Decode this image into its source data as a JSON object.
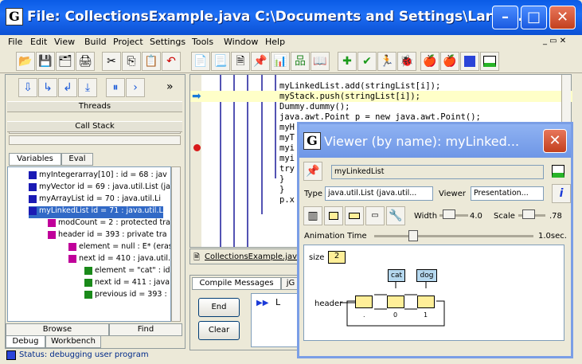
{
  "window": {
    "title": "File: CollectionsExample.java  C:\\Documents and Settings\\Larry\\..."
  },
  "menu": [
    "File",
    "Edit",
    "View",
    "Build",
    "Project",
    "Settings",
    "Tools",
    "Window",
    "Help"
  ],
  "left_panel": {
    "threads_label": "Threads",
    "callstack_label": "Call Stack",
    "tabs": [
      "Variables",
      "Eval"
    ],
    "tree": [
      {
        "text": "myIntegerarray[10] : id = 68 : jav",
        "color": "#1a1ab4",
        "indent": 26
      },
      {
        "text": "myVector id = 69 : java.util.List (ja",
        "color": "#1a1ab4",
        "indent": 26
      },
      {
        "text": "myArrayList id = 70 : java.util.Li",
        "color": "#1a1ab4",
        "indent": 26
      },
      {
        "text": "myLinkedList id = 71 : java.util.L",
        "color": "#1a1ab4",
        "indent": 26
      },
      {
        "text": "modCount = 2 : protected tra",
        "color": "#c0009a",
        "indent": 50
      },
      {
        "text": "header id = 393 : private tra",
        "color": "#c0009a",
        "indent": 50
      },
      {
        "text": "element = null : E* (eras",
        "color": "#c0009a",
        "indent": 76
      },
      {
        "text": "next id = 410 : java.util.l",
        "color": "#c0009a",
        "indent": 76
      },
      {
        "text": "element = \"cat\" : id",
        "color": "#1a8a1a",
        "indent": 96
      },
      {
        "text": "next id = 411 : java.",
        "color": "#1a8a1a",
        "indent": 96
      },
      {
        "text": "previous id = 393 : ",
        "color": "#1a8a1a",
        "indent": 96
      }
    ],
    "bottom_tabs": [
      "Browse",
      "Find"
    ],
    "mode_tabs": [
      "Debug",
      "Workbench"
    ]
  },
  "status": "Status: debugging user program",
  "editor": {
    "lines": [
      "myLinkedList.add(stringList[i]);",
      "myStack.push(stringList[i]);",
      "Dummy.dummy();",
      "java.awt.Point p = new java.awt.Point();",
      "myH",
      "myT",
      "myi",
      "myi",
      "try",
      "}",
      "}",
      "p.x"
    ],
    "file_tab": "CollectionsExample.java"
  },
  "messages": {
    "tab1": "Compile Messages",
    "tab2": "jG",
    "end_label": "End",
    "clear_label": "Clear",
    "prompt": "L"
  },
  "viewer": {
    "title": "Viewer (by name): myLinked...",
    "name": "myLinkedList",
    "type_label": "Type",
    "type_value": "java.util.List (java.util...",
    "viewer_label": "Viewer",
    "viewer_value": "Presentation...",
    "width_label": "Width",
    "width_value": "4.0",
    "scale_label": "Scale",
    "scale_value": ".78",
    "anim_label": "Animation Time",
    "anim_value": "1.0sec.",
    "size_label": "size",
    "size_value": "2",
    "header_label": "header",
    "val_cat": "cat",
    "val_dog": "dog",
    "idx": [
      ".",
      "0",
      "1"
    ]
  }
}
